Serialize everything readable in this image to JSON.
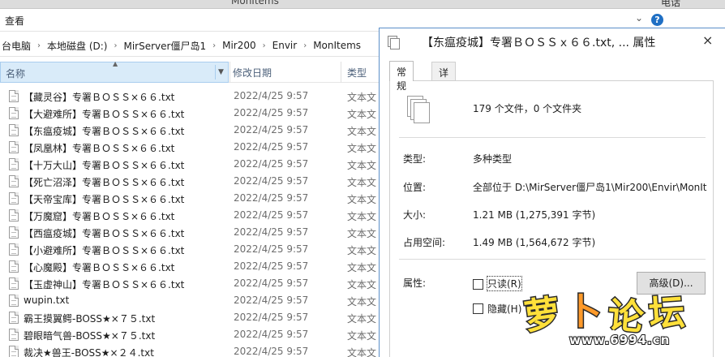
{
  "explorer": {
    "window_title": "MonItems",
    "top_right_text": "电话",
    "ribbon": {
      "view_tab": "查看",
      "help": "?"
    },
    "breadcrumb": [
      "台电脑",
      "本地磁盘 (D:)",
      "MirServer僵尸岛1",
      "Mir200",
      "Envir",
      "MonItems"
    ],
    "columns": {
      "name": "名称",
      "date": "修改日期",
      "type": "类型"
    },
    "files": [
      {
        "name": "【藏灵谷】专署ＢＯＳＳ×６６.txt",
        "date": "2022/4/25 9:57",
        "type": "文本文"
      },
      {
        "name": "【大避难所】专署ＢＯＳＳ×６６.txt",
        "date": "2022/4/25 9:57",
        "type": "文本文"
      },
      {
        "name": "【东瘟疫城】专署ＢＯＳＳ×６６.txt",
        "date": "2022/4/25 9:57",
        "type": "文本文"
      },
      {
        "name": "【凤凰林】专署ＢＯＳＳ×６６.txt",
        "date": "2022/4/25 9:57",
        "type": "文本文"
      },
      {
        "name": "【十万大山】专署ＢＯＳＳ×６６.txt",
        "date": "2022/4/25 9:57",
        "type": "文本文"
      },
      {
        "name": "【死亡沼泽】专署ＢＯＳＳ×６６.txt",
        "date": "2022/4/25 9:57",
        "type": "文本文"
      },
      {
        "name": "【天帝宝库】专署ＢＯＳＳ×６６.txt",
        "date": "2022/4/25 9:57",
        "type": "文本文"
      },
      {
        "name": "【万魔窟】专署ＢＯＳＳ×６６.txt",
        "date": "2022/4/25 9:57",
        "type": "文本文"
      },
      {
        "name": "【西瘟疫城】专署ＢＯＳＳ×６６.txt",
        "date": "2022/4/25 9:57",
        "type": "文本文"
      },
      {
        "name": "【小避难所】专署ＢＯＳＳ×６６.txt",
        "date": "2022/4/25 9:57",
        "type": "文本文"
      },
      {
        "name": "【心魔殿】专署ＢＯＳＳ×６６.txt",
        "date": "2022/4/25 9:57",
        "type": "文本文"
      },
      {
        "name": "【玉虚神山】专署ＢＯＳＳ×６６.txt",
        "date": "2022/4/25 9:57",
        "type": "文本文"
      },
      {
        "name": "wupin.txt",
        "date": "2022/4/25 9:57",
        "type": "文本文"
      },
      {
        "name": "霸王摸翼鳄-BOSS★×７５.txt",
        "date": "2022/4/25 9:57",
        "type": "文本文"
      },
      {
        "name": "碧眼暗气兽-BOSS★×７５.txt",
        "date": "2022/4/25 9:57",
        "type": "文本文"
      },
      {
        "name": "裁决★兽王-BOSS★×２４.txt",
        "date": "2022/4/25 9:57",
        "type": "文本文"
      }
    ]
  },
  "dialog": {
    "title": "【东瘟疫城】专署ＢＯＳＳｘ６６.txt, ... 属性",
    "close": "×",
    "tabs": [
      "常规",
      "详细信息"
    ],
    "summary": "179 个文件，0 个文件夹",
    "props": {
      "type_label": "类型:",
      "type_value": "多种类型",
      "location_label": "位置:",
      "location_value": "全部位于 D:\\MirServer僵尸岛1\\Mir200\\Envir\\MonIt",
      "size_label": "大小:",
      "size_value": "1.21 MB (1,275,391 字节)",
      "disk_label": "占用空间:",
      "disk_value": "1.49 MB (1,564,672 字节)"
    },
    "attributes": {
      "label": "属性:",
      "readonly": "只读(R)",
      "hidden": "隐藏(H)",
      "advanced": "高级(D)..."
    }
  },
  "watermark": {
    "chars": [
      "萝",
      "卜",
      "论",
      "坛"
    ],
    "url": "www.6994.cn"
  }
}
